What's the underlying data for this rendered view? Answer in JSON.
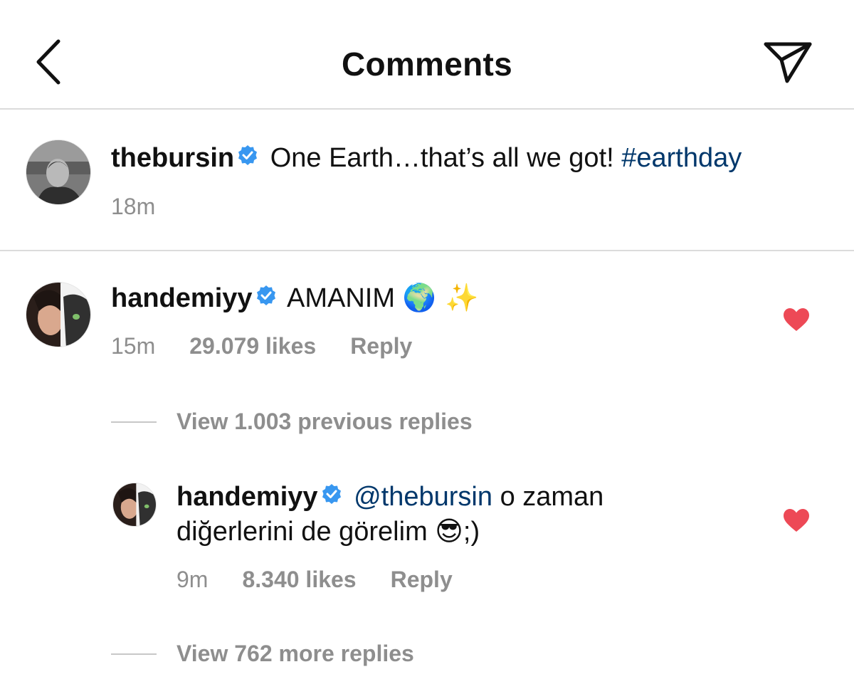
{
  "header": {
    "title": "Comments",
    "back_icon": "chevron-left-icon",
    "share_icon": "paper-plane-icon"
  },
  "caption": {
    "username": "thebursin",
    "text": "One Earth…that’s all we got!",
    "hashtag": "#earthday",
    "time": "18m"
  },
  "comments": [
    {
      "username": "handemiyy",
      "text": "AMANIM",
      "emoji": "🌍 ✨",
      "time": "15m",
      "likes": "29.079 likes",
      "reply_label": "Reply",
      "liked": true,
      "view_previous": "View 1.003 previous replies",
      "replies": [
        {
          "username": "handemiyy",
          "mention": "@thebursin",
          "text_line1": "o zaman",
          "text_line2": "diğerlerini de görelim",
          "emoji": "😎",
          "suffix": ";)",
          "time": "9m",
          "likes": "8.340 likes",
          "reply_label": "Reply",
          "liked": true
        }
      ],
      "view_more": "View 762 more replies"
    }
  ],
  "colors": {
    "verified_blue": "#3897f0",
    "link_blue": "#00376b",
    "heart_red": "#ed4956",
    "meta_gray": "#8e8e8e"
  }
}
